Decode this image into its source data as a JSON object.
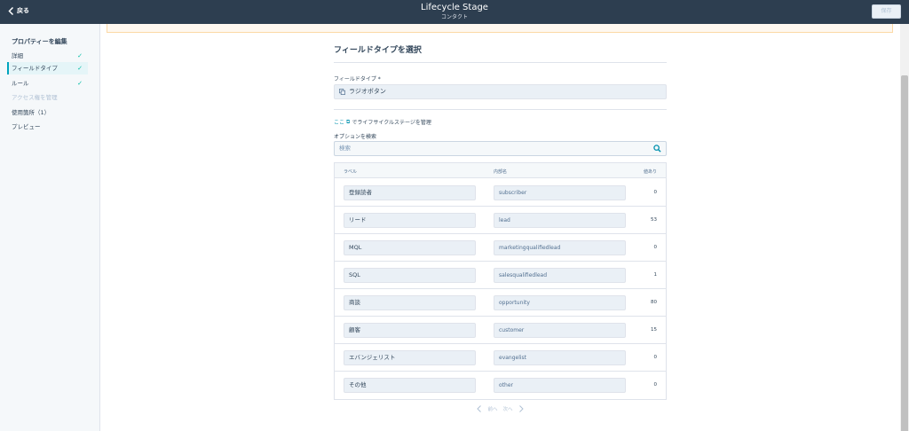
{
  "header": {
    "back_label": "戻る",
    "title": "Lifecycle Stage",
    "subtitle": "コンタクト",
    "save_label": "保存"
  },
  "sidebar": {
    "heading": "プロパティーを編集",
    "items": [
      {
        "label": "詳細",
        "check": "✓"
      },
      {
        "label": "フィールドタイプ",
        "check": "✓"
      },
      {
        "label": "ルール",
        "check": "✓"
      },
      {
        "label": "アクセス権を管理",
        "check": ""
      },
      {
        "label": "使用箇所（1）",
        "check": ""
      },
      {
        "label": "プレビュー",
        "check": ""
      }
    ]
  },
  "main": {
    "section_title": "フィールドタイプを選択",
    "field_type_label": "フィールドタイプ *",
    "field_type_value": "ラジオボタン",
    "manage_link": "ここ",
    "manage_text": "でライフサイクルステージを管理",
    "options_search_label": "オプションを検索",
    "search_placeholder": "検索",
    "table": {
      "headers": [
        "ラベル",
        "内部名",
        "値あり"
      ],
      "rows": [
        {
          "label": "登録読者",
          "internal": "subscriber",
          "count": "0"
        },
        {
          "label": "リード",
          "internal": "lead",
          "count": "53"
        },
        {
          "label": "MQL",
          "internal": "marketingqualifiedlead",
          "count": "0"
        },
        {
          "label": "SQL",
          "internal": "salesqualifiedlead",
          "count": "1"
        },
        {
          "label": "商談",
          "internal": "opportunity",
          "count": "80"
        },
        {
          "label": "顧客",
          "internal": "customer",
          "count": "15"
        },
        {
          "label": "エバンジェリスト",
          "internal": "evangelist",
          "count": "0"
        },
        {
          "label": "その他",
          "internal": "other",
          "count": "0"
        }
      ]
    },
    "pager": {
      "prev": "前へ",
      "next": "次へ"
    }
  },
  "colors": {
    "topbar": "#2d3e50",
    "accent": "#00a4bd",
    "check": "#00bda5",
    "link": "#0091ae"
  }
}
